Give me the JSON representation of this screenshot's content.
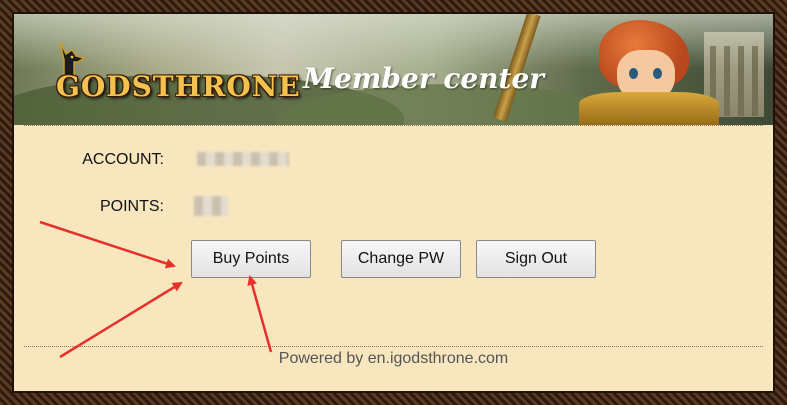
{
  "header": {
    "logo_text": "GODSTHRONE",
    "title": "Member center"
  },
  "account": {
    "account_label": "ACCOUNT:",
    "points_label": "POINTS:"
  },
  "actions": {
    "buy_points": "Buy Points",
    "change_pw": "Change PW",
    "sign_out": "Sign Out"
  },
  "footer": {
    "powered_by": "Powered by en.igodsthrone.com"
  },
  "colors": {
    "panel_bg": "#f8e6bf",
    "arrow": "#e8302a",
    "title_text": "#ffffff",
    "logo_gold": "#f2c14e"
  }
}
